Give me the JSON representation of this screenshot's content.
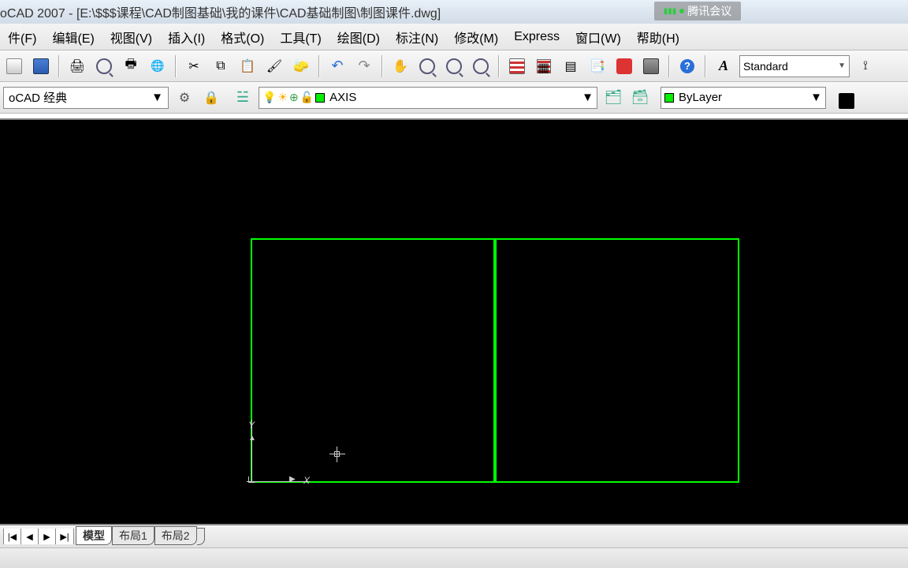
{
  "title": "oCAD 2007 - [E:\\$$$课程\\CAD制图基础\\我的课件\\CAD基础制图\\制图课件.dwg]",
  "overlay_label": "腾讯会议",
  "menu": {
    "file": "件(F)",
    "edit": "编辑(E)",
    "view": "视图(V)",
    "insert": "插入(I)",
    "format": "格式(O)",
    "tools": "工具(T)",
    "draw": "绘图(D)",
    "dimension": "标注(N)",
    "modify": "修改(M)",
    "express": "Express",
    "window": "窗口(W)",
    "help": "帮助(H)"
  },
  "style_combo": "Standard",
  "workspace_combo": "oCAD 经典",
  "layer_combo": "AXIS",
  "color_combo": "ByLayer",
  "tabs": {
    "model": "模型",
    "layout1": "布局1",
    "layout2": "布局2"
  },
  "ucs": {
    "x": "X",
    "y": "Y"
  },
  "help_glyph": "?",
  "nav": {
    "first": "|◀",
    "prev": "◀",
    "next": "▶",
    "last": "▶|"
  }
}
